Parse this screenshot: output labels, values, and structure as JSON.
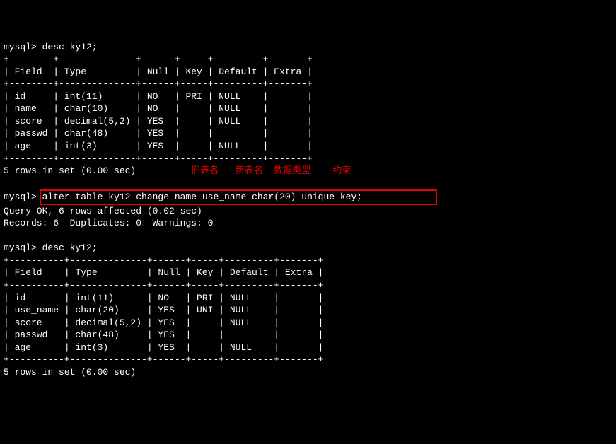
{
  "cmd1_prompt": "mysql> ",
  "cmd1": "desc ky12;",
  "sep1_top": "+--------+--------------+------+-----+---------+-------+",
  "hdr1": "| Field  | Type         | Null | Key | Default | Extra |",
  "sep1_mid": "+--------+--------------+------+-----+---------+-------+",
  "row1_1": "| id     | int(11)      | NO   | PRI | NULL    |       |",
  "row1_2": "| name   | char(10)     | NO   |     | NULL    |       |",
  "row1_3": "| score  | decimal(5,2) | YES  |     | NULL    |       |",
  "row1_4": "| passwd | char(48)     | YES  |     |         |       |",
  "row1_5": "| age    | int(3)       | YES  |     | NULL    |       |",
  "sep1_bot": "+--------+--------------+------+-----+---------+-------+",
  "result1": "5 rows in set (0.00 sec)",
  "label1": "旧表名",
  "label2": "新表名",
  "label3": "数据类型",
  "label4": "约束",
  "cmd2_prompt": "mysql> ",
  "cmd2": "alter table ky12 change name use_name char(20) unique key;",
  "query_ok": "Query OK, 6 rows affected (0.02 sec)",
  "records": "Records: 6  Duplicates: 0  Warnings: 0",
  "cmd3_prompt": "mysql> ",
  "cmd3": "desc ky12;",
  "sep2_top": "+----------+--------------+------+-----+---------+-------+",
  "hdr2": "| Field    | Type         | Null | Key | Default | Extra |",
  "sep2_mid": "+----------+--------------+------+-----+---------+-------+",
  "row2_1": "| id       | int(11)      | NO   | PRI | NULL    |       |",
  "row2_2": "| use_name | char(20)     | YES  | UNI | NULL    |       |",
  "row2_3": "| score    | decimal(5,2) | YES  |     | NULL    |       |",
  "row2_4": "| passwd   | char(48)     | YES  |     |         |       |",
  "row2_5": "| age      | int(3)       | YES  |     | NULL    |       |",
  "sep2_bot": "+----------+--------------+------+-----+---------+-------+",
  "result2": "5 rows in set (0.00 sec)",
  "label_spacing": "          "
}
